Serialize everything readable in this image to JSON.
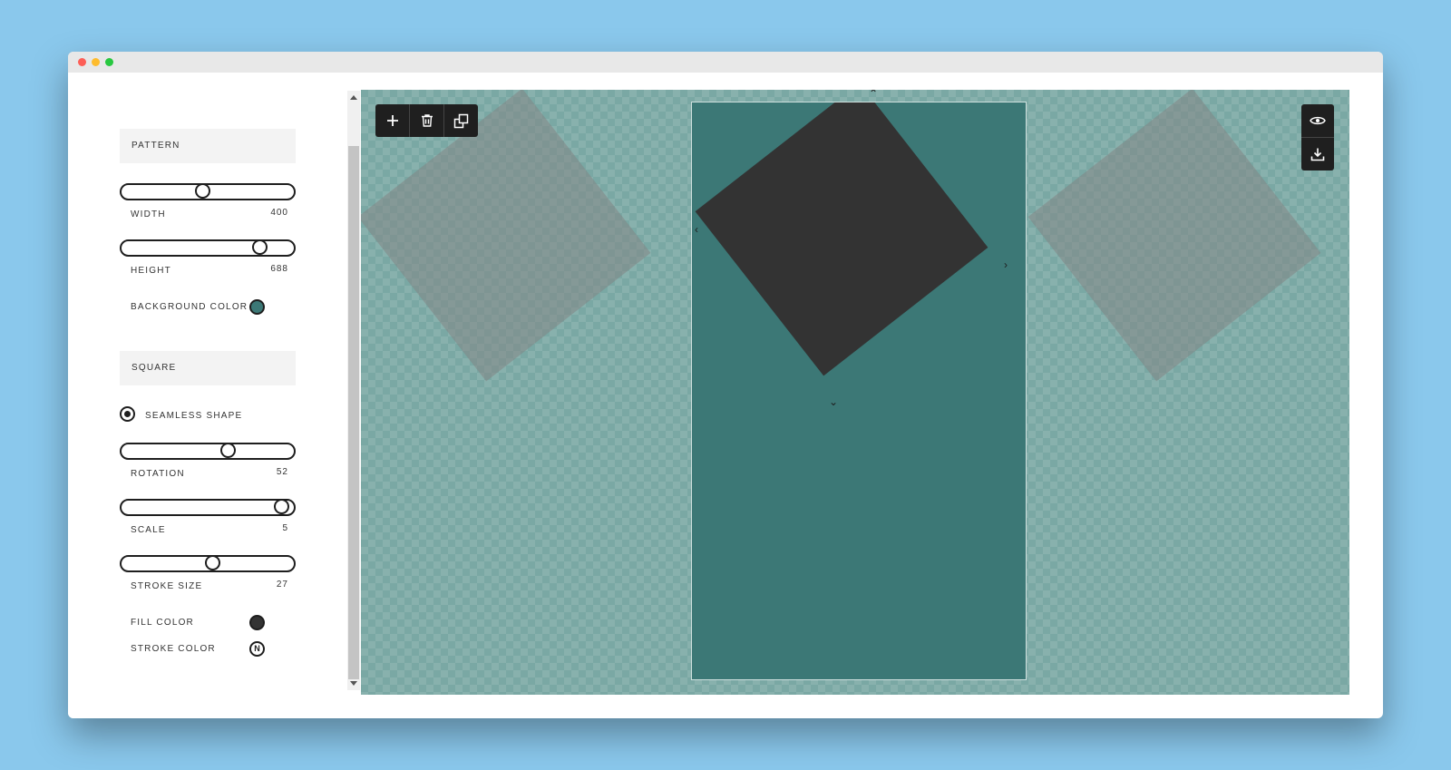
{
  "pattern": {
    "header": "PATTERN",
    "width": {
      "label": "WIDTH",
      "value": "400",
      "fraction": 0.47
    },
    "height": {
      "label": "HEIGHT",
      "value": "688",
      "fraction": 0.83
    },
    "background_color": {
      "label": "BACKGROUND COLOR",
      "color": "#3c7876"
    }
  },
  "square": {
    "header": "SQUARE",
    "seamless": {
      "label": "SEAMLESS SHAPE",
      "checked": true
    },
    "rotation": {
      "label": "ROTATION",
      "value": "52",
      "fraction": 0.63
    },
    "scale": {
      "label": "SCALE",
      "value": "5",
      "fraction": 0.97
    },
    "stroke_size": {
      "label": "STROKE SIZE",
      "value": "27",
      "fraction": 0.53
    },
    "fill_color": {
      "label": "FILL COLOR",
      "color": "#333333"
    },
    "stroke_color": {
      "label": "STROKE COLOR",
      "glyph": "N"
    }
  },
  "canvas": {
    "background": "#7aa8a4",
    "tile_color": "#3c7876",
    "shape_color": "#333333"
  },
  "toolbar": {
    "icons": [
      "plus-icon",
      "trash-icon",
      "duplicate-icon"
    ]
  },
  "side_tools": {
    "icons": [
      "eye-icon",
      "download-icon"
    ]
  }
}
